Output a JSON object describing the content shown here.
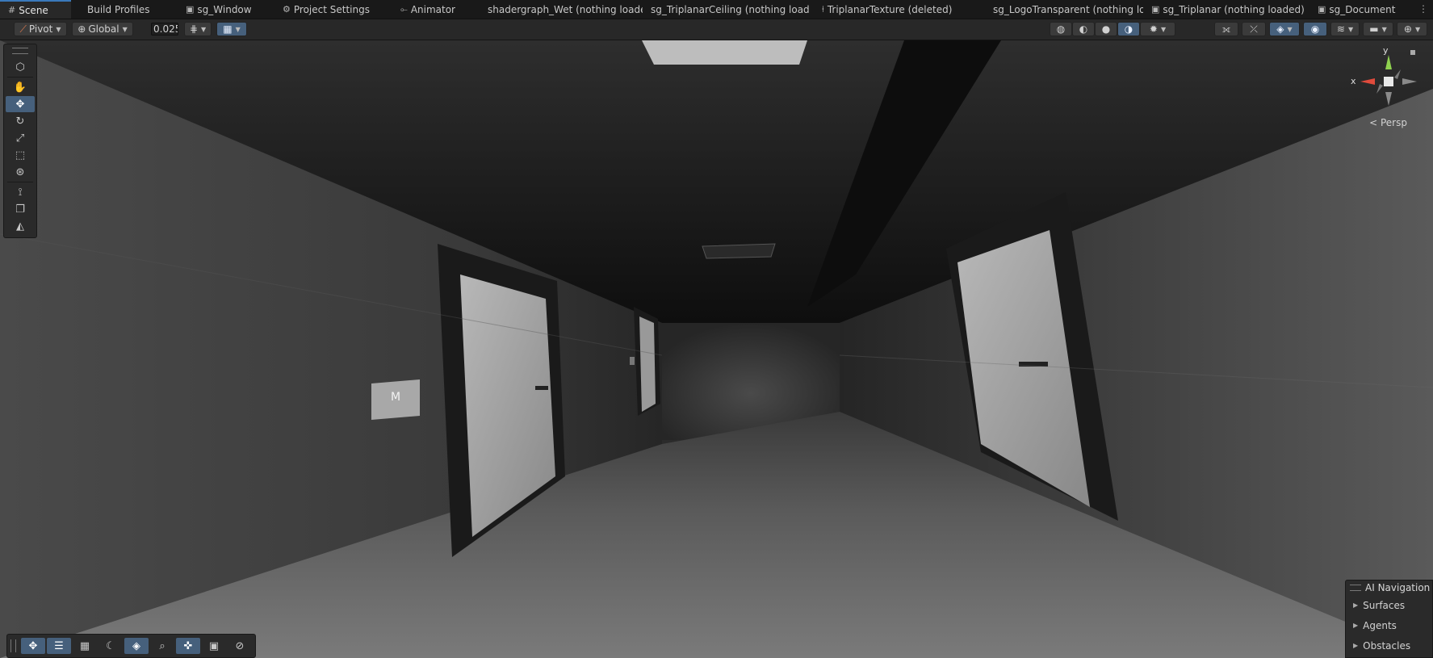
{
  "tabs": [
    {
      "label": "Scene",
      "icon": "grid-icon",
      "active": true
    },
    {
      "label": "Build Profiles",
      "icon": "",
      "active": false
    },
    {
      "label": "sg_Window",
      "icon": "shadergraph-icon",
      "active": false
    },
    {
      "label": "Project Settings",
      "icon": "gear-icon",
      "active": false
    },
    {
      "label": "Animator",
      "icon": "animator-icon",
      "active": false
    },
    {
      "label": "shadergraph_Wet (nothing loade",
      "icon": "",
      "active": false
    },
    {
      "label": "sg_TriplanarCeiling (nothing load",
      "icon": "",
      "active": false
    },
    {
      "label": "TriplanarTexture (deleted)",
      "icon": "subgraph-icon",
      "active": false
    },
    {
      "label": "sg_LogoTransparent (nothing lo",
      "icon": "",
      "active": false
    },
    {
      "label": "sg_Triplanar (nothing loaded)",
      "icon": "shadergraph-icon",
      "active": false
    },
    {
      "label": "sg_Document",
      "icon": "shadergraph-icon",
      "active": false
    }
  ],
  "toolbar": {
    "pivot_label": "Pivot",
    "global_label": "Global",
    "snap_value": "0.025"
  },
  "palette": {
    "tools": [
      "view-cube-icon",
      "hand-icon",
      "move-icon",
      "rotate-icon",
      "scale-icon",
      "rect-icon",
      "transform-icon",
      "custom-tool-icon",
      "duplicate-icon",
      "probe-icon"
    ]
  },
  "gizmo": {
    "x_label": "x",
    "y_label": "y",
    "projection": "< Persp"
  },
  "scene": {
    "sign_text": "M"
  },
  "ai_navigation": {
    "title": "AI Navigation",
    "items": [
      "Surfaces",
      "Agents",
      "Obstacles"
    ]
  },
  "colors": {
    "accent": "#3a79bb",
    "selected_tool": "#46607c",
    "panel": "#2a2a2a"
  }
}
